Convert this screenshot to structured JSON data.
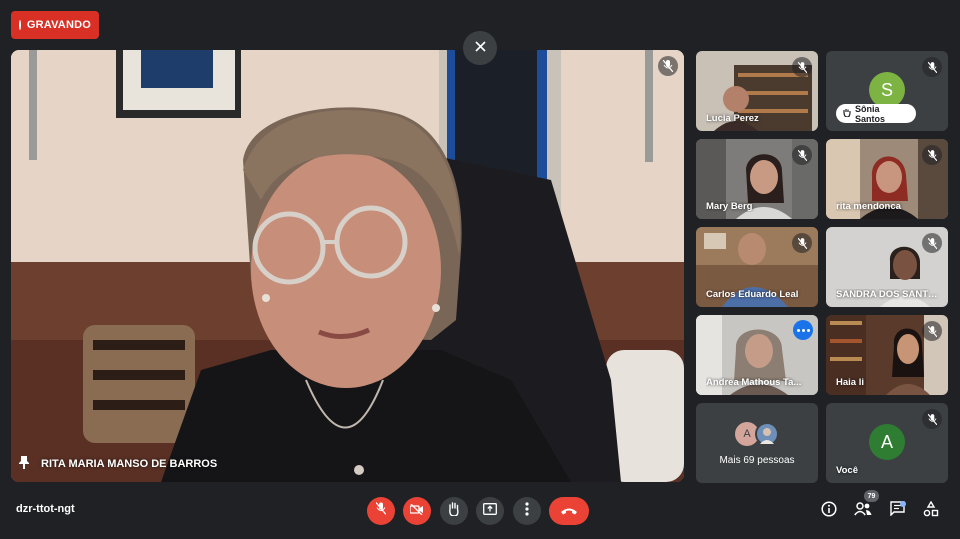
{
  "recording": {
    "label": "GRAVANDO",
    "color": "#d93025"
  },
  "main_speaker": {
    "name": "RITA MARIA MANSO DE BARROS",
    "pinned_icon": "pin-icon"
  },
  "participants": [
    {
      "name": "Lucia Perez",
      "muted": true,
      "type": "video"
    },
    {
      "name": "Sônia Santos",
      "muted": true,
      "type": "avatar",
      "letter": "S",
      "avatar_color": "#7cb342"
    },
    {
      "name": "Mary Berg",
      "muted": true,
      "type": "video"
    },
    {
      "name": "rita mendonca",
      "muted": true,
      "type": "video"
    },
    {
      "name": "Carlos Eduardo Leal",
      "muted": true,
      "type": "video"
    },
    {
      "name": "SANDRA DOS SANTOS",
      "muted": true,
      "type": "video"
    },
    {
      "name": "Andrea Mathous Ta...",
      "muted": false,
      "type": "video",
      "active": true
    },
    {
      "name": "Haia li",
      "muted": true,
      "type": "video"
    },
    {
      "name": "Mais 69 pessoas",
      "type": "more",
      "mini_letter": "A"
    },
    {
      "name": "Você",
      "muted": true,
      "type": "avatar",
      "letter": "A",
      "avatar_color": "#2e7d32"
    }
  ],
  "bottom_bar": {
    "meeting_code": "dzr-ttot-ngt",
    "controls": [
      "mic-off-icon",
      "camera-off-icon",
      "raise-hand-icon",
      "present-icon",
      "more-options-icon",
      "hang-up-icon"
    ],
    "right_icons": [
      "info-icon",
      "people-icon",
      "chat-icon",
      "activities-icon"
    ],
    "people_count": "79"
  },
  "colors": {
    "background": "#202124",
    "tile": "#3c4043",
    "danger": "#ea4335",
    "accent": "#8ab4f8"
  }
}
